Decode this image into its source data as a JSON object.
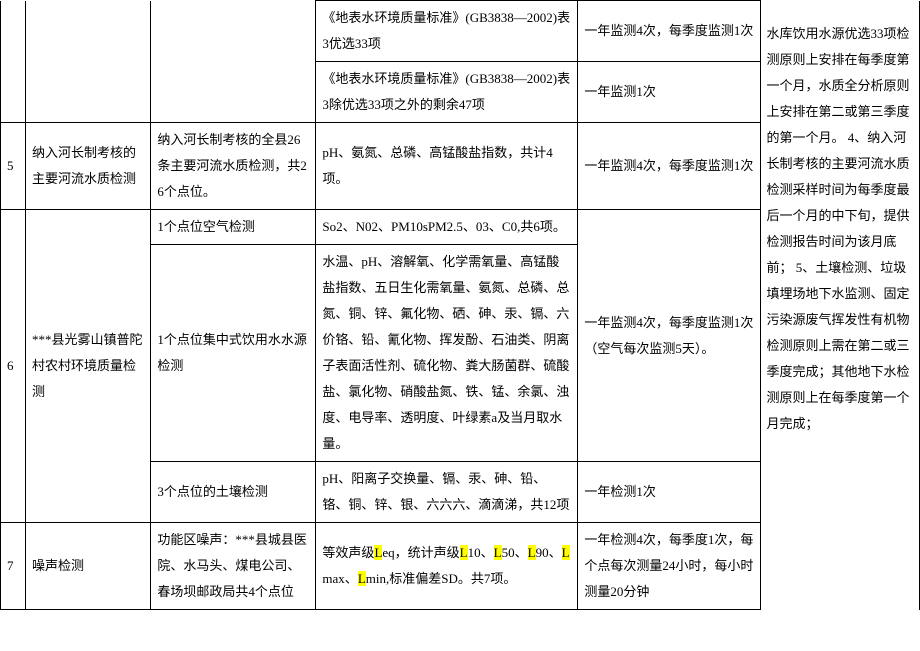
{
  "rows": {
    "r1": {
      "items": "《地表水环境质量标准》(GB3838—2002)表3优选33项",
      "freq": "一年监测4次，每季度监测1次"
    },
    "r2": {
      "items": "《地表水环境质量标准》(GB3838—2002)表3除优选33项之外的剩余47项",
      "freq": "一年监测1次"
    },
    "r3": {
      "num": "5",
      "name": "纳入河长制考核的主要河流水质检测",
      "points": "纳入河长制考核的全县26条主要河流水质检测，共26个点位。",
      "items": "pH、氨氮、总磷、高锰酸盐指数，共计4项。",
      "freq": "一年监测4次，每季度监测1次"
    },
    "r4": {
      "points": "1个点位空气检测",
      "items": "So2、N02、PM10sPM2.5、03、C0,共6项。",
      "freq": ""
    },
    "r5": {
      "num": "6",
      "name": "***县光雾山镇普陀村农村环境质量检测",
      "points": "1个点位集中式饮用水水源检测",
      "items": "水温、pH、溶解氧、化学需氧量、高锰酸盐指数、五日生化需氧量、氨氮、总磷、总氮、铜、锌、氟化物、硒、砷、汞、镉、六价铬、铅、氰化物、挥发酚、石油类、阴离子表面活性剂、硫化物、粪大肠菌群、硫酸盐、氯化物、硝酸盐氮、铁、锰、余氯、浊度、电导率、透明度、叶绿素a及当月取水量。",
      "freq": "一年监测4次，每季度监测1次（空气每次监测5天）。"
    },
    "r6": {
      "points": "3个点位的土壤检测",
      "items": "pH、阳离子交换量、镉、汞、砷、铅、铬、铜、锌、银、六六六、滴滴涕，共12项",
      "freq": "一年检测1次"
    },
    "r7": {
      "num": "7",
      "name": "噪声检测",
      "points": "功能区噪声：***县城县医院、水马头、煤电公司、春场坝邮政局共4个点位",
      "items_prefix": "等效声级",
      "items_h1": "L",
      "items_mid1": "eq，统计声级",
      "items_h2": "L",
      "items_mid2": "10、",
      "items_h3": "L",
      "items_mid3": "50、",
      "items_h4": "L",
      "items_mid4": "90、",
      "items_h5": "L",
      "items_mid5": "max、",
      "items_h6": "L",
      "items_mid6": "min,标准偏差SD。共7项。",
      "freq": "一年检测4次，每季度1次，每个点每次测量24小时，每小时测量20分钟"
    },
    "remarks": "水库饮用水源优选33项检测原则上安排在每季度第一个月，水质全分析原则上安排在第二或第三季度的第一个月。\n4、纳入河长制考核的主要河流水质检测采样时间为每季度最后一个月的中下旬，提供检测报告时间为该月底前；\n5、土壤检测、垃圾填埋场地下水监测、固定污染源废气挥发性有机物检测原则上需在第二或三季度完成；其他地下水检测原则上在每季度第一个月完成；"
  }
}
